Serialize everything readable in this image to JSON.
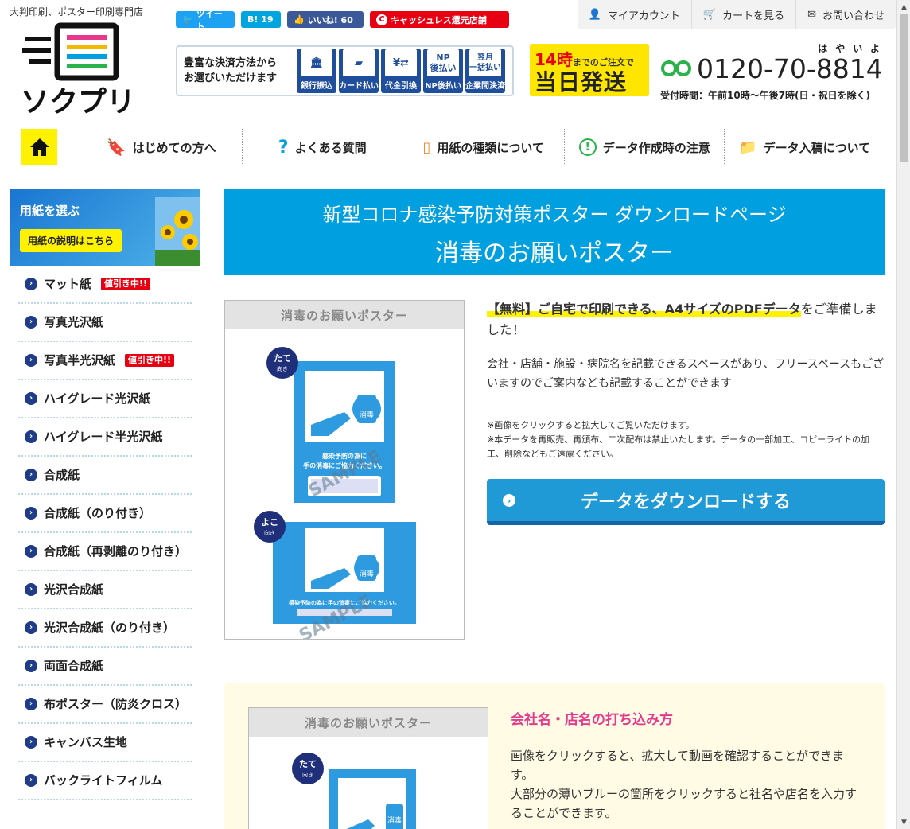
{
  "header": {
    "tagline": "大判印刷、ポスター印刷専門店",
    "logo_text": "ソクプリ",
    "social": {
      "tweet": "ツイート",
      "hatena": "B! 19",
      "like": "いいね! 60",
      "cashless": "キャッシュレス還元店舗"
    },
    "top_links": [
      "マイアカウント",
      "カートを見る",
      "お問い合わせ"
    ],
    "payment": {
      "text_line1": "豊富な決済方法から",
      "text_line2": "お選びいただけます",
      "methods": [
        {
          "icon": "🏛",
          "label": "銀行振込"
        },
        {
          "icon": "▰",
          "label": "カード払い"
        },
        {
          "icon": "¥⇄",
          "label": "代金引換"
        },
        {
          "icon": "NP\n後払い",
          "label": "NP後払い"
        },
        {
          "icon": "翌月\n一括払い",
          "label": "企業間決済"
        }
      ]
    },
    "sameday": {
      "hour": "14時",
      "line1_rest": "までのご注文で",
      "line2": "当日発送"
    },
    "phone": {
      "kana": "はやいよ",
      "number": "0120-70-8814",
      "hours": "受付時間：午前10時～午後7時(日・祝日を除く)"
    }
  },
  "nav": {
    "items": [
      "はじめての方へ",
      "よくある質問",
      "用紙の種類について",
      "データ作成時の注意",
      "データ入稿について"
    ]
  },
  "sidebar": {
    "banner_title": "用紙を選ぶ",
    "banner_button": "用紙の説明はこちら",
    "items": [
      {
        "label": "マット紙",
        "badge": "値引き中!!"
      },
      {
        "label": "写真光沢紙",
        "badge": ""
      },
      {
        "label": "写真半光沢紙",
        "badge": "値引き中!!"
      },
      {
        "label": "ハイグレード光沢紙",
        "badge": ""
      },
      {
        "label": "ハイグレード半光沢紙",
        "badge": ""
      },
      {
        "label": "合成紙",
        "badge": ""
      },
      {
        "label": "合成紙（のり付き）",
        "badge": ""
      },
      {
        "label": "合成紙（再剥離のり付き）",
        "badge": ""
      },
      {
        "label": "光沢合成紙",
        "badge": ""
      },
      {
        "label": "光沢合成紙（のり付き）",
        "badge": ""
      },
      {
        "label": "両面合成紙",
        "badge": ""
      },
      {
        "label": "布ポスター（防炎クロス）",
        "badge": ""
      },
      {
        "label": "キャンバス生地",
        "badge": ""
      },
      {
        "label": "バックライトフィルム",
        "badge": ""
      }
    ]
  },
  "hero": {
    "subtitle": "新型コロナ感染予防対策ポスター ダウンロードページ",
    "title": "消毒のお願いポスター"
  },
  "poster": {
    "title": "消毒のお願いポスター",
    "tate": "たて",
    "tate_sub": "向き",
    "yoko": "よこ",
    "yoko_sub": "向き",
    "sample": "SAMPLE",
    "bottle_label": "消毒",
    "message_line1": "感染予防の為に",
    "message_line2": "手の消毒にご協力ください。",
    "message_wide": "感染予防の為に手の消毒にご協力ください。"
  },
  "info": {
    "highlight": "【無料】ご自宅で印刷できる、A4サイズのPDFデータ",
    "text1_rest": "をご準備しました！",
    "text2": "会社・店舗・施設・病院名を記載できるスペースがあり、フリースペースもございますのでご案内なども記載することができます",
    "note1": "※画像をクリックすると拡大してご覧いただけます。",
    "note2": "※本データを再販売、再頒布、二次配布は禁止いたします。データの一部加工、コピーライトの加工、削除などもご遠慮ください。"
  },
  "download": {
    "label": "データをダウンロードする"
  },
  "section2": {
    "poster_title": "消毒のお願いポスター",
    "title": "会社名・店名の打ち込み方",
    "body": "画像をクリックすると、拡大して動画を確認することができます。\n大部分の薄いブルーの箇所をクリックすると社名や店名を入力することができます。"
  },
  "colors": {
    "brand_blue": "#00a0e0",
    "accent_yellow": "#fff200",
    "badge_red": "#e60012",
    "pink_title": "#e6398c"
  }
}
